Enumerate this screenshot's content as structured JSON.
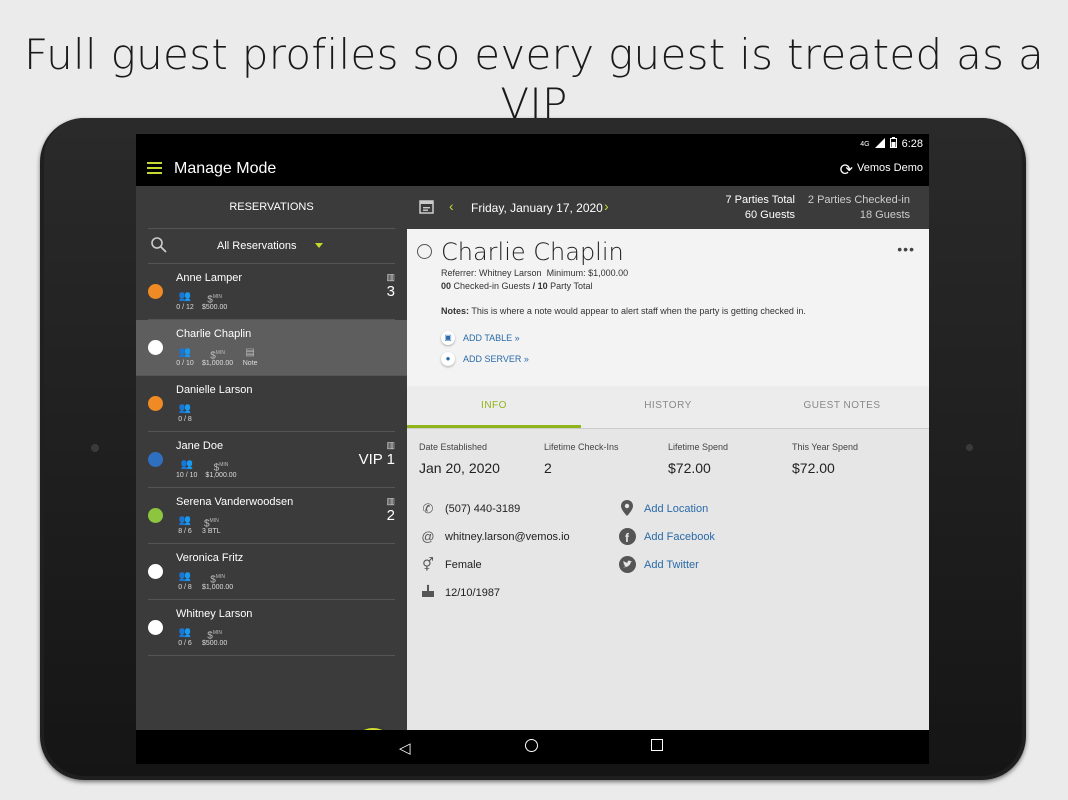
{
  "headline": "Full guest profiles so every guest is treated as a VIP",
  "status_bar": {
    "network": "4G",
    "time": "6:28"
  },
  "app_bar": {
    "title": "Manage Mode",
    "account": "Vemos Demo"
  },
  "sidebar": {
    "header": "RESERVATIONS",
    "filter": "All Reservations",
    "items": [
      {
        "name": "Anne Lamper",
        "dot_color": "#f08a24",
        "guests": "0 / 12",
        "min": "$500.00",
        "note": "",
        "table": "3",
        "selected": false
      },
      {
        "name": "Charlie Chaplin",
        "dot_color": "#ffffff",
        "guests": "0 / 10",
        "min": "$1,000.00",
        "note": "Note",
        "table": "",
        "selected": true
      },
      {
        "name": "Danielle Larson",
        "dot_color": "#f08a24",
        "guests": "0 / 8",
        "min": "",
        "note": "",
        "table": "",
        "selected": false
      },
      {
        "name": "Jane Doe",
        "dot_color": "#2f6fbf",
        "guests": "10 / 10",
        "min": "$1,000.00",
        "note": "",
        "table": "VIP 1",
        "selected": false
      },
      {
        "name": "Serena Vanderwoodsen",
        "dot_color": "#8cc63f",
        "guests": "8 / 6",
        "min": "3 BTL",
        "note": "",
        "table": "2",
        "selected": false
      },
      {
        "name": "Veronica Fritz",
        "dot_color": "#ffffff",
        "guests": "0 / 8",
        "min": "$1,000.00",
        "note": "",
        "table": "",
        "selected": false
      },
      {
        "name": "Whitney Larson",
        "dot_color": "#ffffff",
        "guests": "0 / 6",
        "min": "$500.00",
        "note": "",
        "table": "",
        "selected": false
      }
    ],
    "min_label": "MIN"
  },
  "date_strip": {
    "date": "Friday, January 17, 2020",
    "parties_total": "7 Parties Total",
    "guests_total": "60 Guests",
    "parties_checked": "2 Parties Checked-in",
    "guests_checked": "18 Guests"
  },
  "profile": {
    "name": "Charlie Chaplin",
    "referrer_label": "Referrer:",
    "referrer": "Whitney Larson",
    "minimum_label": "Minimum:",
    "minimum": "$1,000.00",
    "checked_in": "00",
    "checked_in_label": "Checked-in Guests",
    "party_total": "10",
    "party_total_label": "Party Total",
    "notes_label": "Notes:",
    "notes": "This is where a note would appear to alert staff when the party is getting checked in.",
    "add_table": "ADD TABLE »",
    "add_server": "ADD SERVER »"
  },
  "tabs": [
    "INFO",
    "HISTORY",
    "GUEST NOTES"
  ],
  "info": {
    "stats": [
      {
        "label": "Date Established",
        "value": "Jan 20, 2020"
      },
      {
        "label": "Lifetime Check-Ins",
        "value": "2"
      },
      {
        "label": "Lifetime Spend",
        "value": "$72.00"
      },
      {
        "label": "This Year Spend",
        "value": "$72.00"
      }
    ],
    "phone": "(507) 440-3189",
    "email": "whitney.larson@vemos.io",
    "gender": "Female",
    "birthday": "12/10/1987",
    "add_location": "Add Location",
    "add_facebook": "Add Facebook",
    "add_twitter": "Add Twitter"
  },
  "colors": {
    "accent": "#c6d92e",
    "link": "#2a6aa8",
    "sidebar": "#3b3b3b"
  }
}
